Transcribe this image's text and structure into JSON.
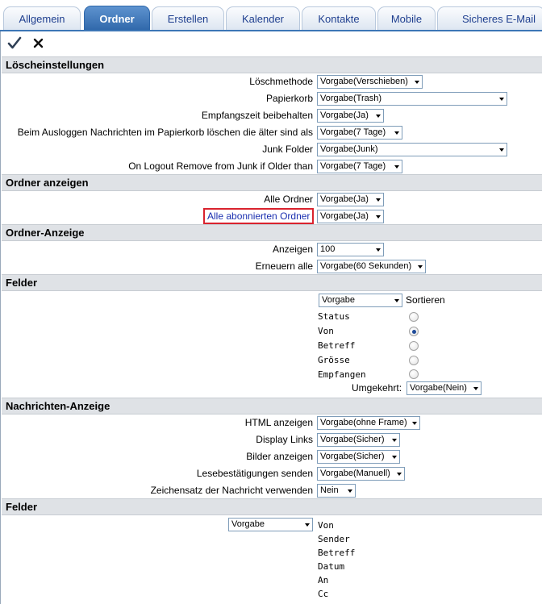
{
  "tabs": [
    {
      "label": "Allgemein",
      "active": false
    },
    {
      "label": "Ordner",
      "active": true
    },
    {
      "label": "Erstellen",
      "active": false
    },
    {
      "label": "Kalender",
      "active": false
    },
    {
      "label": "Kontakte",
      "active": false
    },
    {
      "label": "Mobile",
      "active": false
    },
    {
      "label": "Sicheres E-Mail",
      "active": false
    }
  ],
  "toolbar": {
    "save_icon": "checkmark-icon",
    "cancel_icon": "close-icon"
  },
  "sections": {
    "loeschen": {
      "title": "Löscheinstellungen",
      "rows": [
        {
          "label": "Löschmethode",
          "value": "Vorgabe(Verschieben)"
        },
        {
          "label": "Papierkorb",
          "value": "Vorgabe(Trash)"
        },
        {
          "label": "Empfangszeit beibehalten",
          "value": "Vorgabe(Ja)"
        },
        {
          "label": "Beim Ausloggen Nachrichten im Papierkorb löschen die älter sind als",
          "value": "Vorgabe(7 Tage)"
        },
        {
          "label": "Junk Folder",
          "value": "Vorgabe(Junk)"
        },
        {
          "label": "On Logout Remove from Junk if Older than",
          "value": "Vorgabe(7 Tage)"
        }
      ]
    },
    "ordner_anzeigen": {
      "title": "Ordner anzeigen",
      "rows": [
        {
          "label": "Alle Ordner",
          "value": "Vorgabe(Ja)"
        },
        {
          "label": "Alle abonnierten Ordner",
          "value": "Vorgabe(Ja)"
        }
      ]
    },
    "ordner_anzeige": {
      "title": "Ordner-Anzeige",
      "rows": [
        {
          "label": "Anzeigen",
          "value": "100"
        },
        {
          "label": "Erneuern alle",
          "value": "Vorgabe(60 Sekunden)"
        }
      ]
    },
    "felder1": {
      "title": "Felder",
      "sort_select": "Vorgabe",
      "sort_label": "Sortieren",
      "fields": [
        {
          "label": "Status",
          "checked": false
        },
        {
          "label": "Von",
          "checked": true
        },
        {
          "label": "Betreff",
          "checked": false
        },
        {
          "label": "Grösse",
          "checked": false
        },
        {
          "label": "Empfangen",
          "checked": false
        }
      ],
      "reverse_label": "Umgekehrt:",
      "reverse_value": "Vorgabe(Nein)"
    },
    "nachrichten": {
      "title": "Nachrichten-Anzeige",
      "rows": [
        {
          "label": "HTML anzeigen",
          "value": "Vorgabe(ohne Frame)"
        },
        {
          "label": "Display Links",
          "value": "Vorgabe(Sicher)"
        },
        {
          "label": "Bilder anzeigen",
          "value": "Vorgabe(Sicher)"
        },
        {
          "label": "Lesebestätigungen senden",
          "value": "Vorgabe(Manuell)"
        },
        {
          "label": "Zeichensatz der Nachricht verwenden",
          "value": "Nein"
        }
      ]
    },
    "felder2": {
      "title": "Felder",
      "select": "Vorgabe",
      "fields": [
        "Von",
        "Sender",
        "Betreff",
        "Datum",
        "An",
        "Cc"
      ]
    }
  },
  "colors": {
    "accent": "#2f67aa",
    "link": "#1a2fb0",
    "highlight": "#d9232e"
  }
}
